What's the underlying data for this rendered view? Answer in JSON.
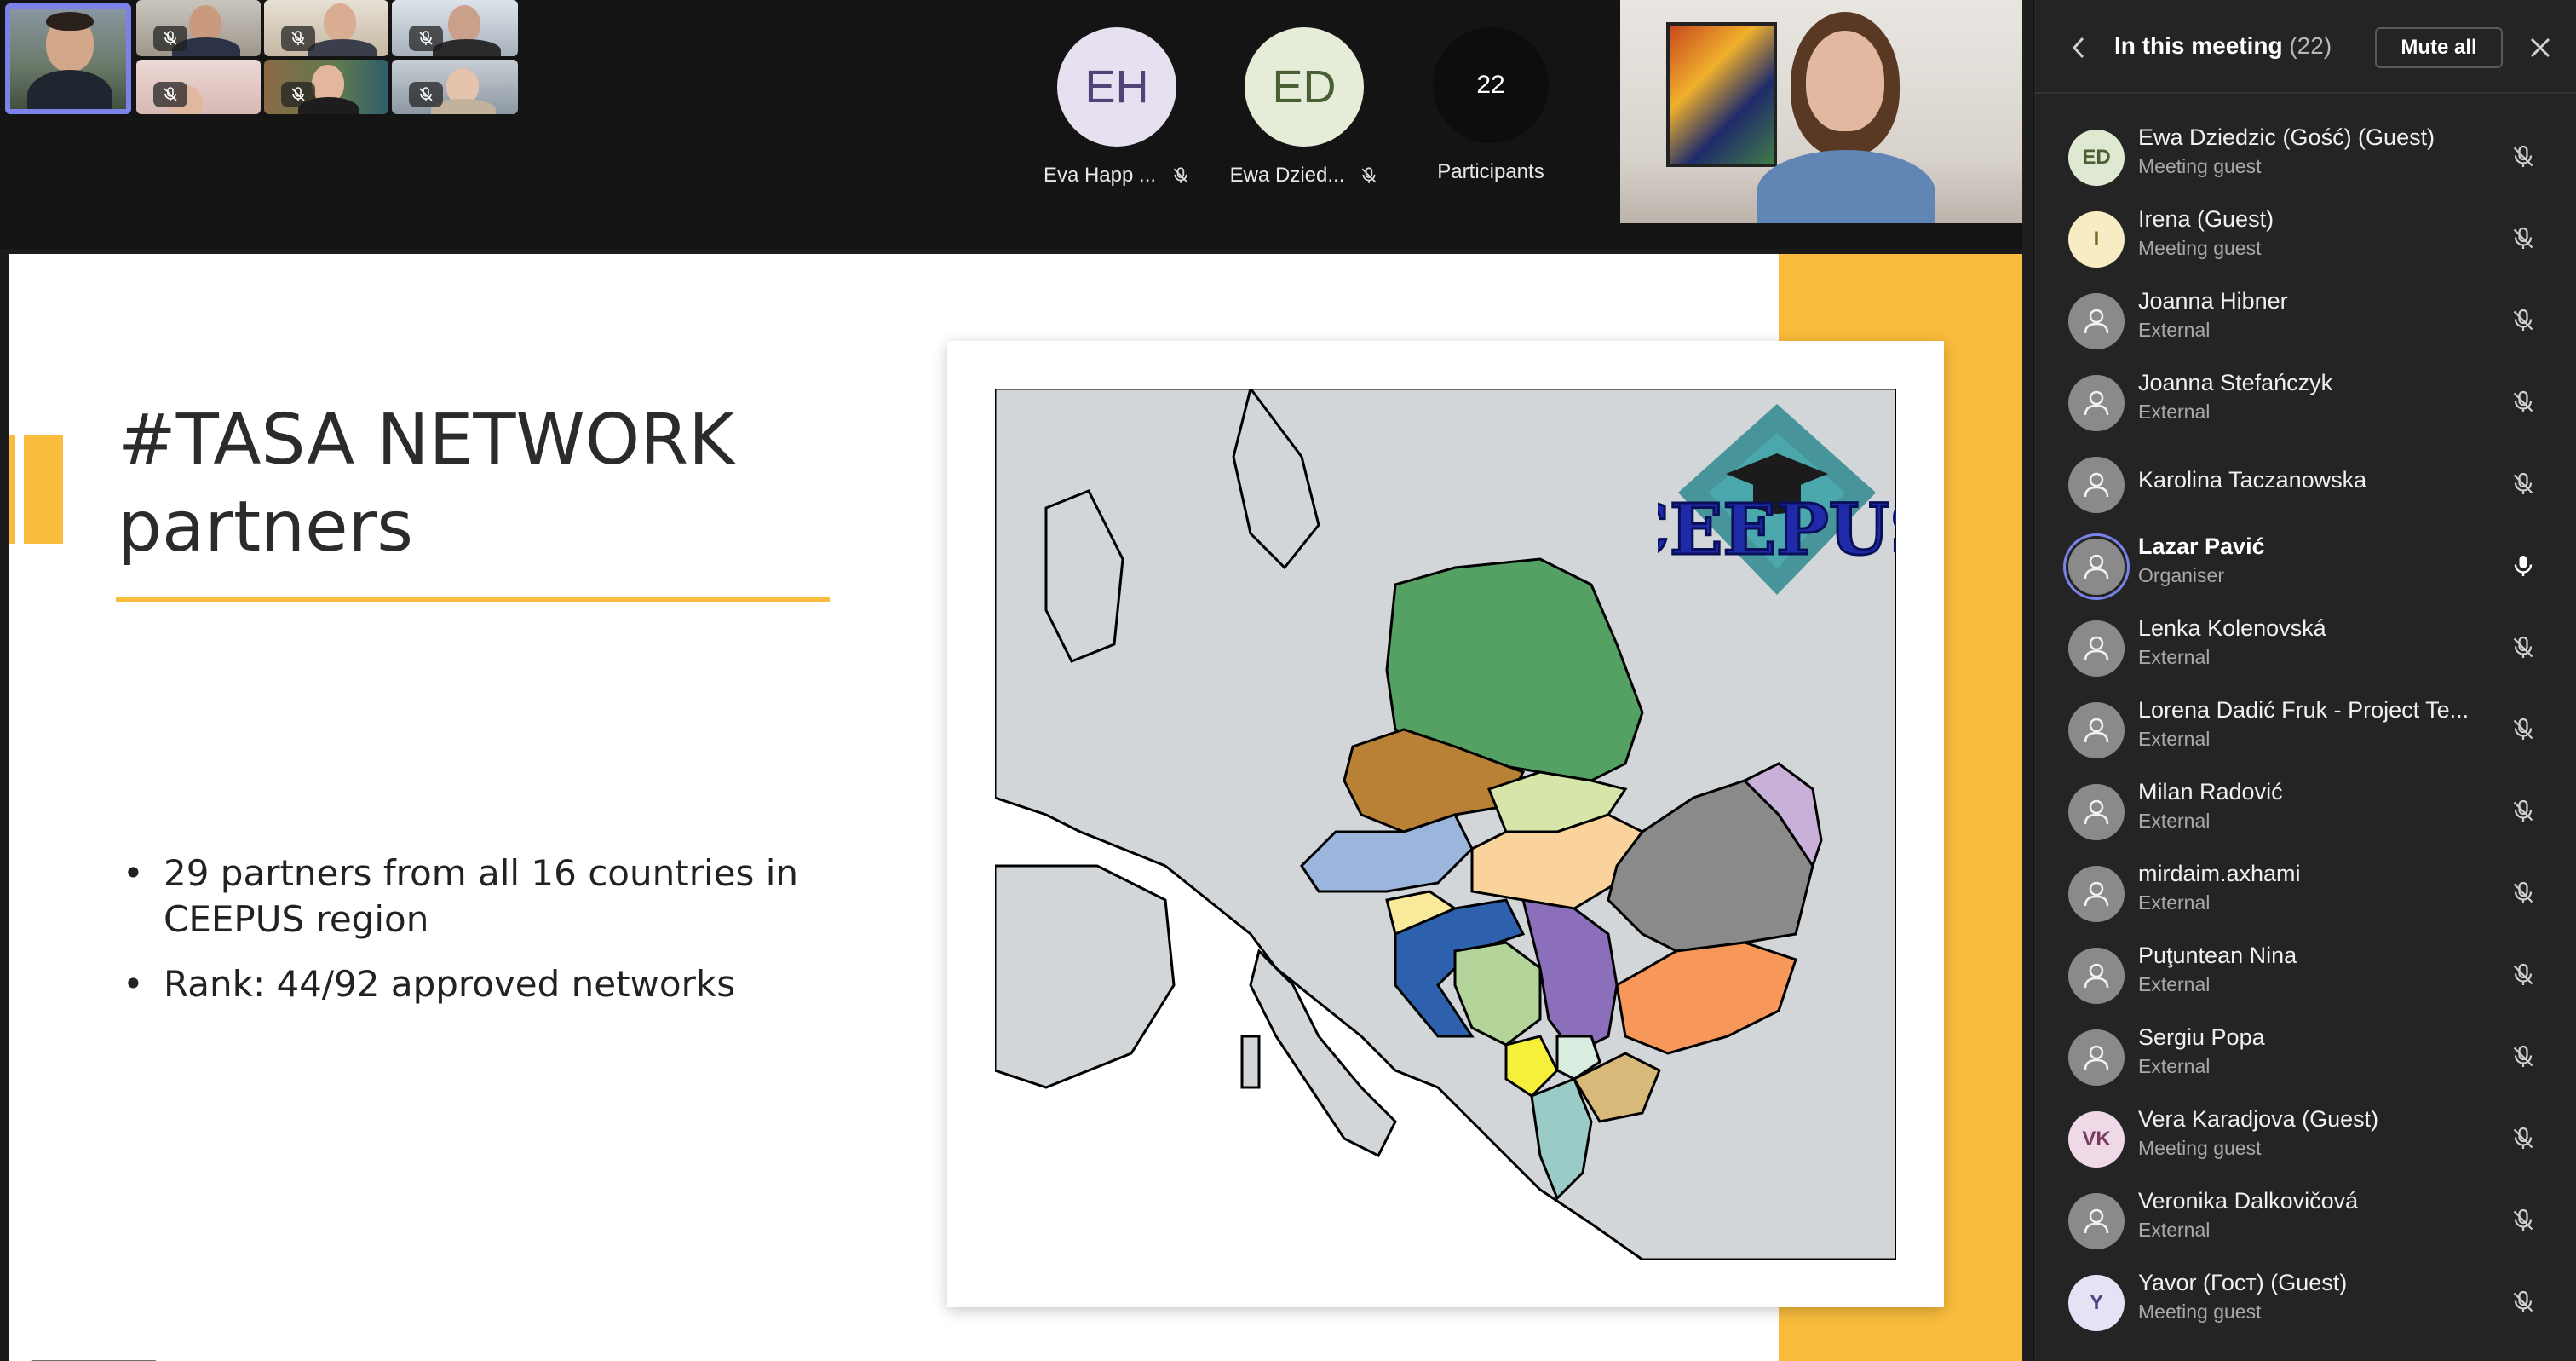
{
  "video_strip": {
    "tiles": [
      {
        "muted": false,
        "active": true
      },
      {
        "muted": true
      },
      {
        "muted": true
      },
      {
        "muted": true
      },
      {
        "muted": true
      },
      {
        "muted": true
      },
      {
        "muted": true
      }
    ],
    "avatars": [
      {
        "initials": "EH",
        "name": "Eva Happ ...",
        "muted": true
      },
      {
        "initials": "ED",
        "name": "Ewa Dzied...",
        "muted": true
      }
    ],
    "participants_tile": {
      "count": "22",
      "label": "Participants"
    }
  },
  "slide": {
    "title_line1": "#TASA NETWORK",
    "title_line2": "partners",
    "bullets": [
      "29 partners from all 16 countries in CEEPUS region",
      "Rank: 44/92 approved networks"
    ],
    "logo_text": "CEEPUS"
  },
  "panel": {
    "title": "In this meeting",
    "count": "(22)",
    "mute_all_label": "Mute all",
    "participants": [
      {
        "initials": "ED",
        "name": "Ewa Dziedzic (Gość) (Guest)",
        "role": "Meeting guest",
        "avatar": "initials",
        "color": "#dfe9d2",
        "fg": "#4a5f34",
        "mic": "muted"
      },
      {
        "initials": "I",
        "name": "Irena (Guest)",
        "role": "Meeting guest",
        "avatar": "initials",
        "color": "#f8ecc4",
        "fg": "#7a6a2a",
        "mic": "muted"
      },
      {
        "initials": "",
        "name": "Joanna Hibner",
        "role": "External",
        "avatar": "person",
        "color": "#8a8a8a",
        "mic": "muted"
      },
      {
        "initials": "",
        "name": "Joanna Stefańczyk",
        "role": "External",
        "avatar": "person",
        "color": "#8a8a8a",
        "mic": "muted"
      },
      {
        "initials": "",
        "name": "Karolina Taczanowska",
        "role": "",
        "avatar": "person",
        "color": "#8a8a8a",
        "mic": "muted"
      },
      {
        "initials": "",
        "name": "Lazar Pavić",
        "role": "Organiser",
        "avatar": "person",
        "color": "#8a8a8a",
        "mic": "on",
        "speaking": true
      },
      {
        "initials": "",
        "name": "Lenka Kolenovská",
        "role": "External",
        "avatar": "person",
        "color": "#8a8a8a",
        "mic": "muted"
      },
      {
        "initials": "",
        "name": "Lorena Dadić Fruk - Project Te...",
        "role": "External",
        "avatar": "person",
        "color": "#8a8a8a",
        "mic": "muted"
      },
      {
        "initials": "",
        "name": "Milan Radović",
        "role": "External",
        "avatar": "person",
        "color": "#8a8a8a",
        "mic": "muted"
      },
      {
        "initials": "",
        "name": "mirdaim.axhami",
        "role": "External",
        "avatar": "person",
        "color": "#8a8a8a",
        "mic": "muted"
      },
      {
        "initials": "",
        "name": "Puţuntean Nina",
        "role": "External",
        "avatar": "person",
        "color": "#8a8a8a",
        "mic": "muted"
      },
      {
        "initials": "",
        "name": "Sergiu Popa",
        "role": "External",
        "avatar": "person",
        "color": "#8a8a8a",
        "mic": "muted"
      },
      {
        "initials": "VK",
        "name": "Vera Karadjova (Guest)",
        "role": "Meeting guest",
        "avatar": "initials",
        "color": "#f0d9e6",
        "fg": "#7a3b60",
        "mic": "muted"
      },
      {
        "initials": "",
        "name": "Veronika Dalkovičová",
        "role": "External",
        "avatar": "person",
        "color": "#8a8a8a",
        "mic": "muted"
      },
      {
        "initials": "Y",
        "name": "Yavor (Гост) (Guest)",
        "role": "Meeting guest",
        "avatar": "initials",
        "color": "#e4e2f4",
        "fg": "#4b4785",
        "mic": "muted"
      }
    ]
  },
  "colors": {
    "accent": "#f9bc3c",
    "teams_purple": "#7b83eb",
    "panel_bg": "#242424"
  },
  "icons": {
    "back": "chevron-left-icon",
    "close": "close-icon",
    "mic_muted": "mic-off-icon",
    "mic_on": "mic-icon",
    "person": "person-icon"
  }
}
